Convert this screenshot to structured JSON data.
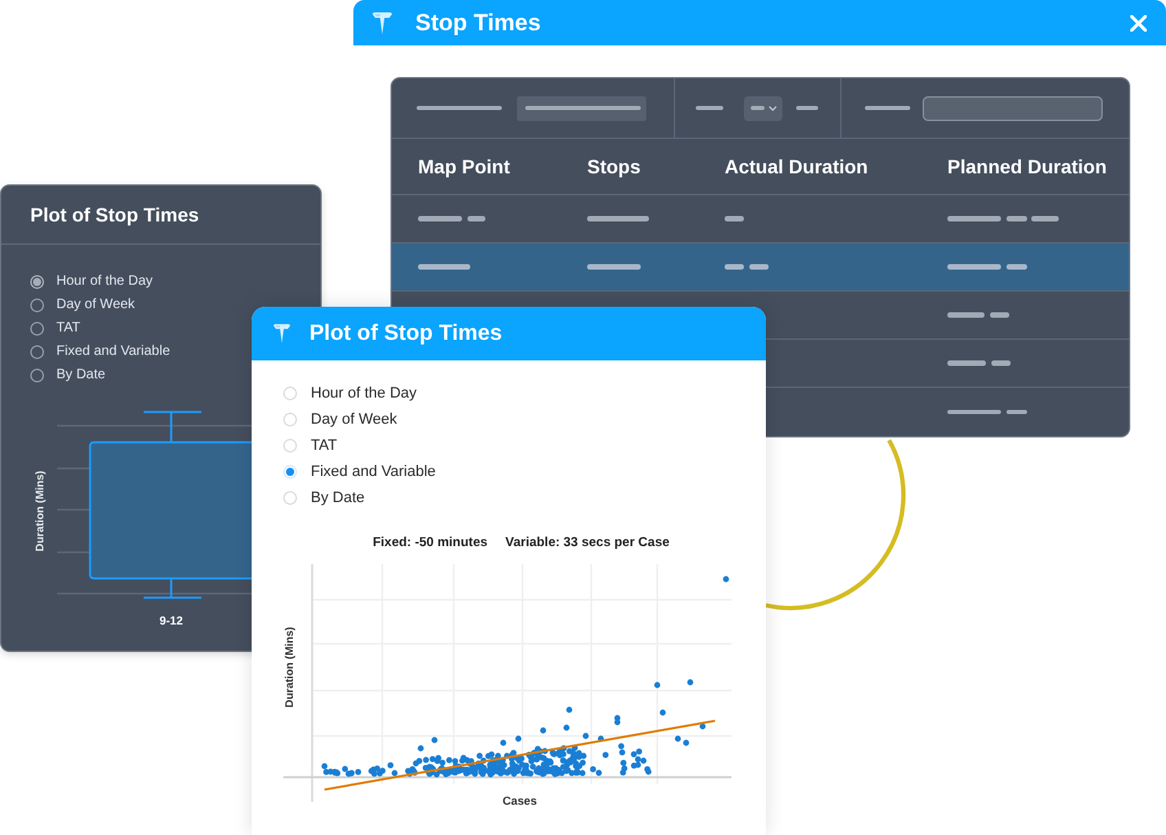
{
  "stop_times_window": {
    "title": "Stop Times",
    "table": {
      "columns": [
        "Map Point",
        "Stops",
        "Actual Duration",
        "Planned Duration"
      ],
      "rows": [
        {
          "selected": false
        },
        {
          "selected": true
        },
        {
          "selected": false
        },
        {
          "selected": false
        },
        {
          "selected": false
        }
      ]
    }
  },
  "left_panel": {
    "title": "Plot of Stop Times",
    "options": [
      {
        "label": "Hour of the Day",
        "selected": true
      },
      {
        "label": "Day of Week",
        "selected": false
      },
      {
        "label": "TAT",
        "selected": false
      },
      {
        "label": "Fixed and Variable",
        "selected": false
      },
      {
        "label": "By Date",
        "selected": false
      }
    ],
    "chart": {
      "y_label": "Duration (Mins)",
      "category": "9-12"
    }
  },
  "plot_window": {
    "title": "Plot of Stop Times",
    "options": [
      {
        "label": "Hour of the Day",
        "selected": false
      },
      {
        "label": "Day of Week",
        "selected": false
      },
      {
        "label": "TAT",
        "selected": false
      },
      {
        "label": "Fixed and Variable",
        "selected": true
      },
      {
        "label": "By Date",
        "selected": false
      }
    ],
    "chart": {
      "fixed": "Fixed: -50 minutes",
      "variable": "Variable: 33 secs per Case",
      "y_label": "Duration (Mins)",
      "x_label": "Cases"
    }
  }
}
